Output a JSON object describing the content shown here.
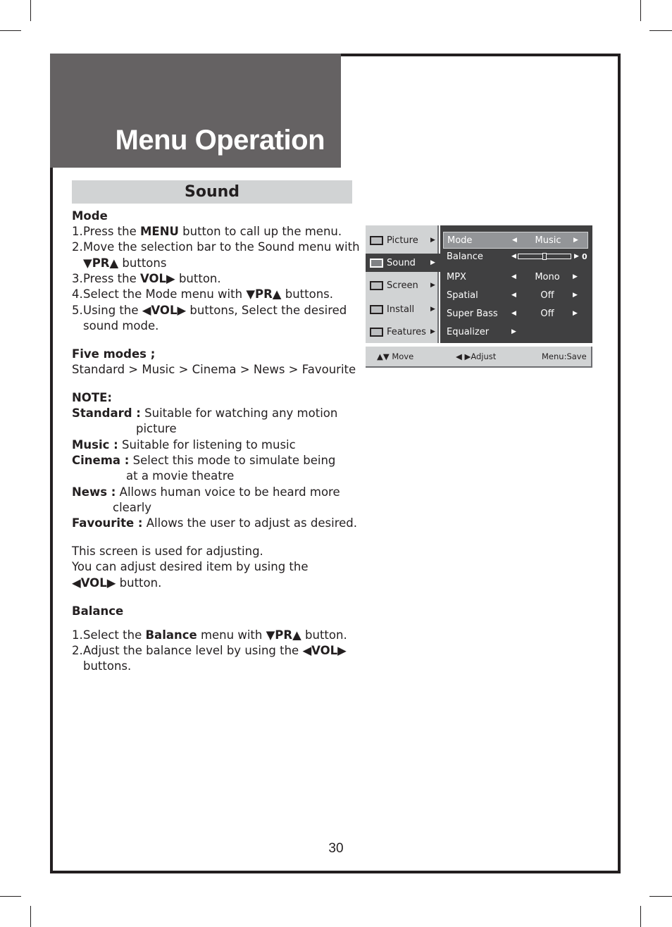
{
  "header": {
    "title": "Menu Operation"
  },
  "section": {
    "title": "Sound"
  },
  "mode": {
    "heading": "Mode",
    "steps": [
      {
        "num": "1.",
        "pre": "Press the ",
        "bold": "MENU",
        "post": " button to call up the menu."
      },
      {
        "num": "2.",
        "pre": "Move the selection bar to the Sound menu with",
        "cont_bold": "▼PR▲",
        "cont_post": " buttons"
      },
      {
        "num": "3.",
        "pre": "Press the ",
        "bold": "VOL▶",
        "post": " button."
      },
      {
        "num": "4.",
        "pre": "Select the Mode menu with ",
        "bold": "▼PR▲",
        "post": " buttons."
      },
      {
        "num": "5.",
        "pre": "Using the ",
        "bold": "◀VOL▶",
        "post": " buttons, Select the desired",
        "cont": "sound mode."
      }
    ]
  },
  "five_modes": {
    "heading": "Five modes ;",
    "list": "Standard > Music > Cinema > News > Favourite"
  },
  "note": {
    "heading": "NOTE:",
    "items": [
      {
        "term": "Standard :",
        "desc": " Suitable for watching any motion",
        "cont": "picture"
      },
      {
        "term": "Music :",
        "desc": " Suitable for listening to music"
      },
      {
        "term": "Cinema :",
        "desc": " Select this mode to simulate being",
        "cont": "at a movie theatre"
      },
      {
        "term": "News :",
        "desc": " Allows human voice to be heard more",
        "cont": "clearly"
      },
      {
        "term": "Favourite :",
        "desc": " Allows the user to adjust as desired."
      }
    ]
  },
  "adjust": {
    "line1": "This screen is used for adjusting.",
    "line2": "You can adjust desired item by using the",
    "line3_bold": "◀VOL▶",
    "line3_post": " button."
  },
  "balance": {
    "heading": "Balance",
    "steps": [
      {
        "num": "1.",
        "pre": "Select the ",
        "bold": "Balance",
        "post": " menu with ",
        "bold2": "▼PR▲",
        "post2": " button."
      },
      {
        "num": "2.",
        "pre": "Adjust the balance level by using the ",
        "bold": "◀VOL▶",
        "cont": "buttons."
      }
    ]
  },
  "osd": {
    "categories": [
      {
        "label": "Picture",
        "icon": "picture-icon",
        "active": false
      },
      {
        "label": "Sound",
        "icon": "speaker-icon",
        "active": true
      },
      {
        "label": "Screen",
        "icon": "screen-icon",
        "active": false
      },
      {
        "label": "Install",
        "icon": "monitor-icon",
        "active": false
      },
      {
        "label": "Features",
        "icon": "tools-icon",
        "active": false
      }
    ],
    "items": [
      {
        "label": "Mode",
        "value": "Music",
        "selected": true
      },
      {
        "label": "Balance",
        "value": "0",
        "balance_fraction": 0.5
      },
      {
        "label": "MPX",
        "value": "Mono"
      },
      {
        "label": "Spatial",
        "value": "Off"
      },
      {
        "label": "Super Bass",
        "value": "Off"
      },
      {
        "label": "Equalizer",
        "value": ""
      }
    ],
    "footer": {
      "move": "▲▼ Move",
      "adjust": "◀ ▶Adjust",
      "save": "Menu:Save"
    },
    "left_arrow": "◀",
    "right_arrow": "▶"
  },
  "page_number": "30"
}
